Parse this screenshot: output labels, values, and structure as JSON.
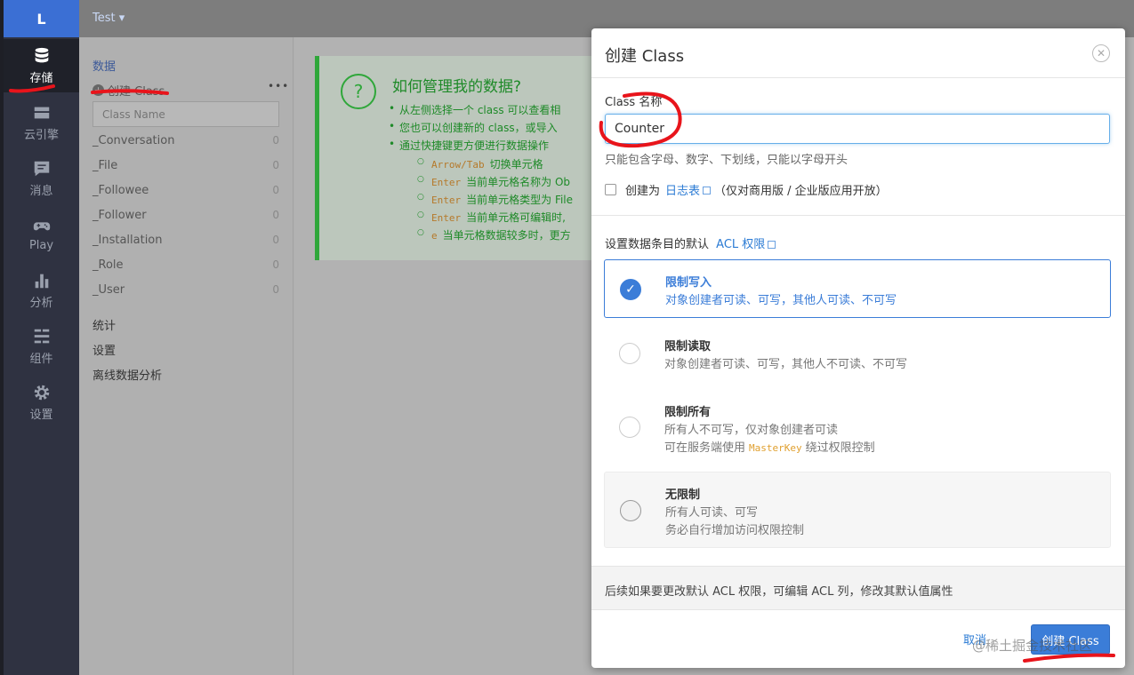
{
  "nav": {
    "logo": "L",
    "items": [
      {
        "label": "存储",
        "icon": "database-icon"
      },
      {
        "label": "云引擎",
        "icon": "cloud-engine-icon"
      },
      {
        "label": "消息",
        "icon": "message-icon"
      },
      {
        "label": "Play",
        "icon": "gamepad-icon"
      },
      {
        "label": "分析",
        "icon": "bar-chart-icon"
      },
      {
        "label": "组件",
        "icon": "components-icon"
      },
      {
        "label": "设置",
        "icon": "gear-icon"
      }
    ]
  },
  "topbar": {
    "app_name": "Test ▾"
  },
  "sidebar": {
    "section_title": "数据",
    "create_label": "创建 Class",
    "more": "•••",
    "search_placeholder": "Class Name",
    "classes": [
      {
        "name": "_Conversation",
        "count": "0"
      },
      {
        "name": "_File",
        "count": "0"
      },
      {
        "name": "_Followee",
        "count": "0"
      },
      {
        "name": "_Follower",
        "count": "0"
      },
      {
        "name": "_Installation",
        "count": "0"
      },
      {
        "name": "_Role",
        "count": "0"
      },
      {
        "name": "_User",
        "count": "0"
      }
    ],
    "links": [
      "统计",
      "设置",
      "离线数据分析"
    ]
  },
  "help": {
    "icon": "?",
    "title": "如何管理我的数据?",
    "items": [
      "从左侧选择一个 class 可以查看相",
      "您也可以创建新的 class，或导入",
      "通过快捷键更方便进行数据操作"
    ],
    "shortcuts": [
      {
        "key": "Arrow/Tab",
        "text": "切换单元格"
      },
      {
        "key": "Enter",
        "text": "当前单元格名称为 Ob"
      },
      {
        "key": "Enter",
        "text": "当前单元格类型为 File"
      },
      {
        "key": "Enter",
        "text": "当前单元格可编辑时,"
      },
      {
        "key": "e",
        "text": "当单元格数据较多时，更方"
      }
    ]
  },
  "modal": {
    "title": "创建 Class",
    "close": "✕",
    "name_label": "Class 名称",
    "name_value": "Counter",
    "name_help": "只能包含字母、数字、下划线，只能以字母开头",
    "log_prefix": "创建为",
    "log_link": "日志表",
    "log_suffix": "（仅对商用版 / 企业版应用开放）",
    "acl_prefix": "设置数据条目的默认",
    "acl_link": "ACL 权限",
    "options": [
      {
        "title": "限制写入",
        "desc": "对象创建者可读、可写，其他人可读、不可写"
      },
      {
        "title": "限制读取",
        "desc": "对象创建者可读、可写，其他人不可读、不可写"
      },
      {
        "title": "限制所有",
        "desc": "所有人不可写，仅对象创建者可读",
        "desc2_prefix": "可在服务端使用",
        "desc2_code": "MasterKey",
        "desc2_suffix": "绕过权限控制"
      },
      {
        "title": "无限制",
        "desc": "所有人可读、可写",
        "desc2": "务必自行增加访问权限控制"
      }
    ],
    "note": "后续如果要更改默认 ACL 权限，可编辑 ACL 列，修改其默认值属性",
    "cancel": "取消",
    "create": "创建 Class"
  },
  "watermark": "@稀土掘金技术社区"
}
